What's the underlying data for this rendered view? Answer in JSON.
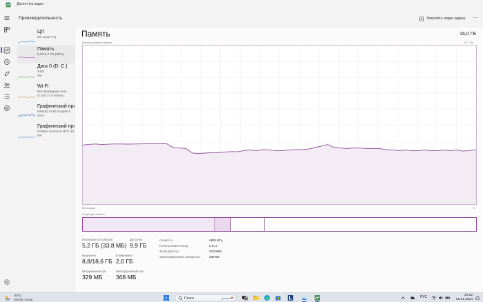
{
  "window": {
    "title": "Диспетчер задач"
  },
  "header": {
    "page_title": "Производительность",
    "run_task_label": "Запустить новую задачу",
    "more_label": "···"
  },
  "sidebar": {
    "items": [
      {
        "name": "ЦП",
        "sub1": "8% 3,04 ГГц",
        "sub2": "",
        "sub3": ""
      },
      {
        "name": "Память",
        "sub1": "5,9/15,7 ГБ (38%)",
        "sub2": "",
        "sub3": ""
      },
      {
        "name": "Диск 0 (D: C:)",
        "sub1": "SSD",
        "sub2": "4%",
        "sub3": ""
      },
      {
        "name": "Wi-Fi",
        "sub1": "Беспроводная сеть",
        "sub2": "О: 8,0 П: 0 Кбит/с",
        "sub3": ""
      },
      {
        "name": "Графический прс",
        "sub1": "Intel(R) UHD Graphics",
        "sub2": "21%",
        "sub3": ""
      },
      {
        "name": "Графический прс",
        "sub1": "NVIDIA GeForce RTX 40",
        "sub2": "0%",
        "sub3": ""
      }
    ]
  },
  "main": {
    "title": "Память",
    "total": "16,0 ГБ",
    "usage_label": "Использование памяти",
    "max_label": "15,7 ГБ",
    "time_left": "60 секунд",
    "time_right": "0",
    "structure_label": "Структура памяти"
  },
  "memory_usage": {
    "max_gb": 15.7,
    "values_gb": [
      5.85,
      5.92,
      5.95,
      5.9,
      5.93,
      5.95,
      5.95,
      5.94,
      5.95,
      5.96,
      5.98,
      5.98,
      5.98,
      5.97,
      5.6,
      5.55,
      5.5,
      5.05,
      5.02,
      5.05,
      5.1,
      5.1,
      5.15,
      5.2,
      5.18,
      5.3,
      5.35,
      5.3,
      5.4,
      5.35,
      5.3,
      5.3,
      5.35,
      5.4,
      5.4,
      5.45,
      5.6,
      5.75,
      5.9,
      5.6,
      5.55,
      5.5,
      5.55,
      5.55,
      5.5,
      5.5,
      5.5,
      5.4,
      5.35,
      5.3,
      5.35,
      5.3,
      5.3,
      5.35,
      5.3,
      5.3,
      5.35,
      5.3,
      5.35,
      5.25,
      5.3,
      5.4
    ]
  },
  "composition": {
    "in_use": 5.2,
    "modified": 0.65,
    "standby": 1.3,
    "free": 8.55
  },
  "stats": {
    "in_use_label": "Используется (сжатая)",
    "in_use_value": "5,2 ГБ (33,8 МБ)",
    "available_label": "Доступно",
    "available_value": "9,9 ГБ",
    "committed_label": "Выделено",
    "committed_value": "8,8/18,6 ГБ",
    "cached_label": "Кэшировано",
    "cached_value": "2,0 ГБ",
    "paged_label": "Выгружаемый пул",
    "paged_value": "329 МБ",
    "nonpaged_label": "Невыгружаемый пул",
    "nonpaged_value": "368 МБ"
  },
  "specs": [
    {
      "k": "Скорость:",
      "v": "4800 МГц"
    },
    {
      "k": "Использовано гнезд:",
      "v": "2 из 2"
    },
    {
      "k": "Форм-фактор:",
      "v": "SODIMM"
    },
    {
      "k": "Зарезервировано аппаратно:",
      "v": "260 МБ"
    }
  ],
  "taskbar": {
    "temp": "-16°C",
    "condition": "Mostly cloudy",
    "search_placeholder": "Поиск",
    "lang": "РУС",
    "time": "20:52",
    "date": "08.01.2024"
  },
  "colors": {
    "accent": "#5b5fc7",
    "memory_line": "#8e4a97",
    "memory_fill": "#f3ecf5"
  }
}
